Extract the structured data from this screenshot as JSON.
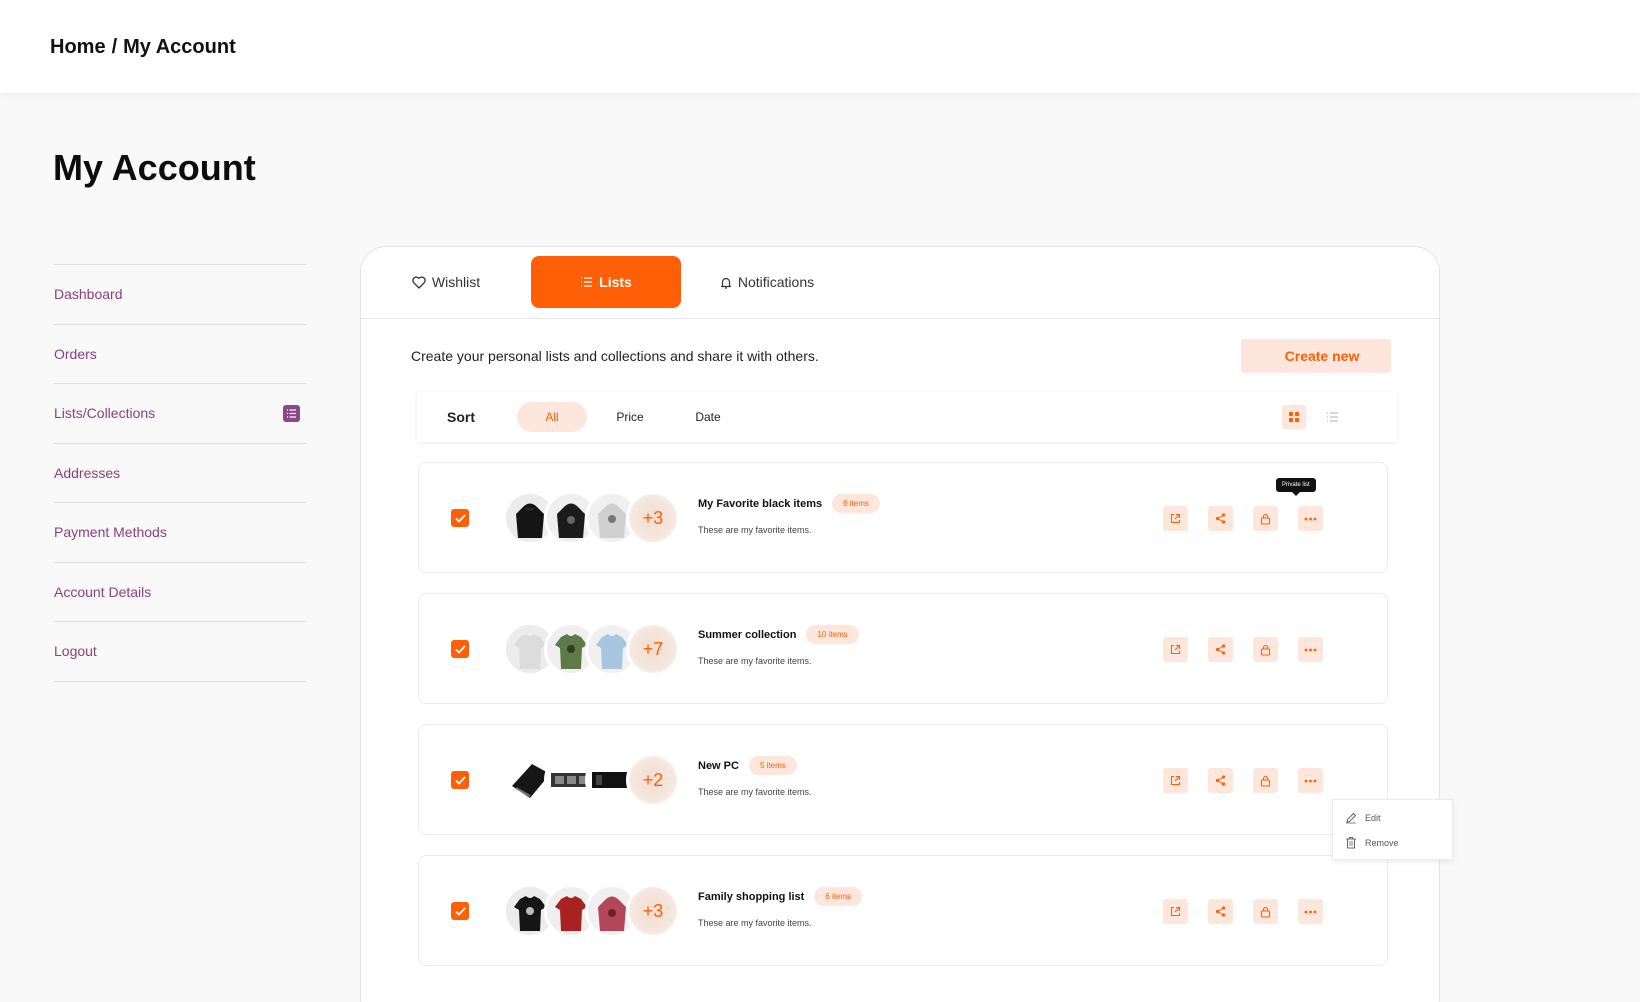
{
  "breadcrumb": {
    "home": "Home",
    "separator": "/",
    "current": "My Account"
  },
  "page_title": "My Account",
  "sidebar": {
    "items": [
      {
        "label": "Dashboard"
      },
      {
        "label": "Orders"
      },
      {
        "label": "Lists/Collections",
        "badge_icon": "list-icon"
      },
      {
        "label": "Addresses"
      },
      {
        "label": "Payment Methods"
      },
      {
        "label": "Account Details"
      },
      {
        "label": "Logout"
      }
    ]
  },
  "tabs": [
    {
      "label": "Wishlist",
      "icon": "heart-icon",
      "active": false
    },
    {
      "label": "Lists",
      "icon": "list-icon",
      "active": true
    },
    {
      "label": "Notifications",
      "icon": "bell-icon",
      "active": false
    }
  ],
  "intro_text": "Create your personal lists and collections and share it with others.",
  "create_button": {
    "icon": "plus",
    "label": "Create new"
  },
  "sort": {
    "label": "Sort",
    "options": [
      {
        "label": "All",
        "active": true
      },
      {
        "label": "Price",
        "active": false
      },
      {
        "label": "Date",
        "active": false
      }
    ],
    "view": "grid"
  },
  "lists": [
    {
      "title": "My Favorite black items",
      "count": "6 items",
      "description": "These are my favorite items.",
      "more": "+3",
      "checked": true,
      "thumbs": [
        "black-hoodie",
        "black-hoodie-print",
        "grey-hoodie"
      ]
    },
    {
      "title": "Summer collection",
      "count": "10 items",
      "description": "These are my favorite items.",
      "more": "+7",
      "checked": true,
      "thumbs": [
        "white-tshirt",
        "green-tshirt",
        "blue-tshirt"
      ]
    },
    {
      "title": "New PC",
      "count": "5 items",
      "description": "These are my favorite items.",
      "more": "+2",
      "checked": true,
      "thumbs": [
        "graphics-card",
        "graphics-card-flat",
        "graphics-card-black"
      ]
    },
    {
      "title": "Family shopping list",
      "count": "6 items",
      "description": "These are my favorite items.",
      "more": "+3",
      "checked": true,
      "thumbs": [
        "black-tshirt",
        "red-tshirt",
        "red-hoodie"
      ]
    }
  ],
  "tooltip": "Private list",
  "dropdown": {
    "items": [
      {
        "label": "Edit",
        "icon": "pencil-icon"
      },
      {
        "label": "Remove",
        "icon": "trash-icon"
      }
    ]
  },
  "colors": {
    "accent": "#ff5f06",
    "accent_soft": "#fde6dc",
    "sidebar_link": "#8a3f7f",
    "sidebar_badge": "#8a4a86"
  }
}
